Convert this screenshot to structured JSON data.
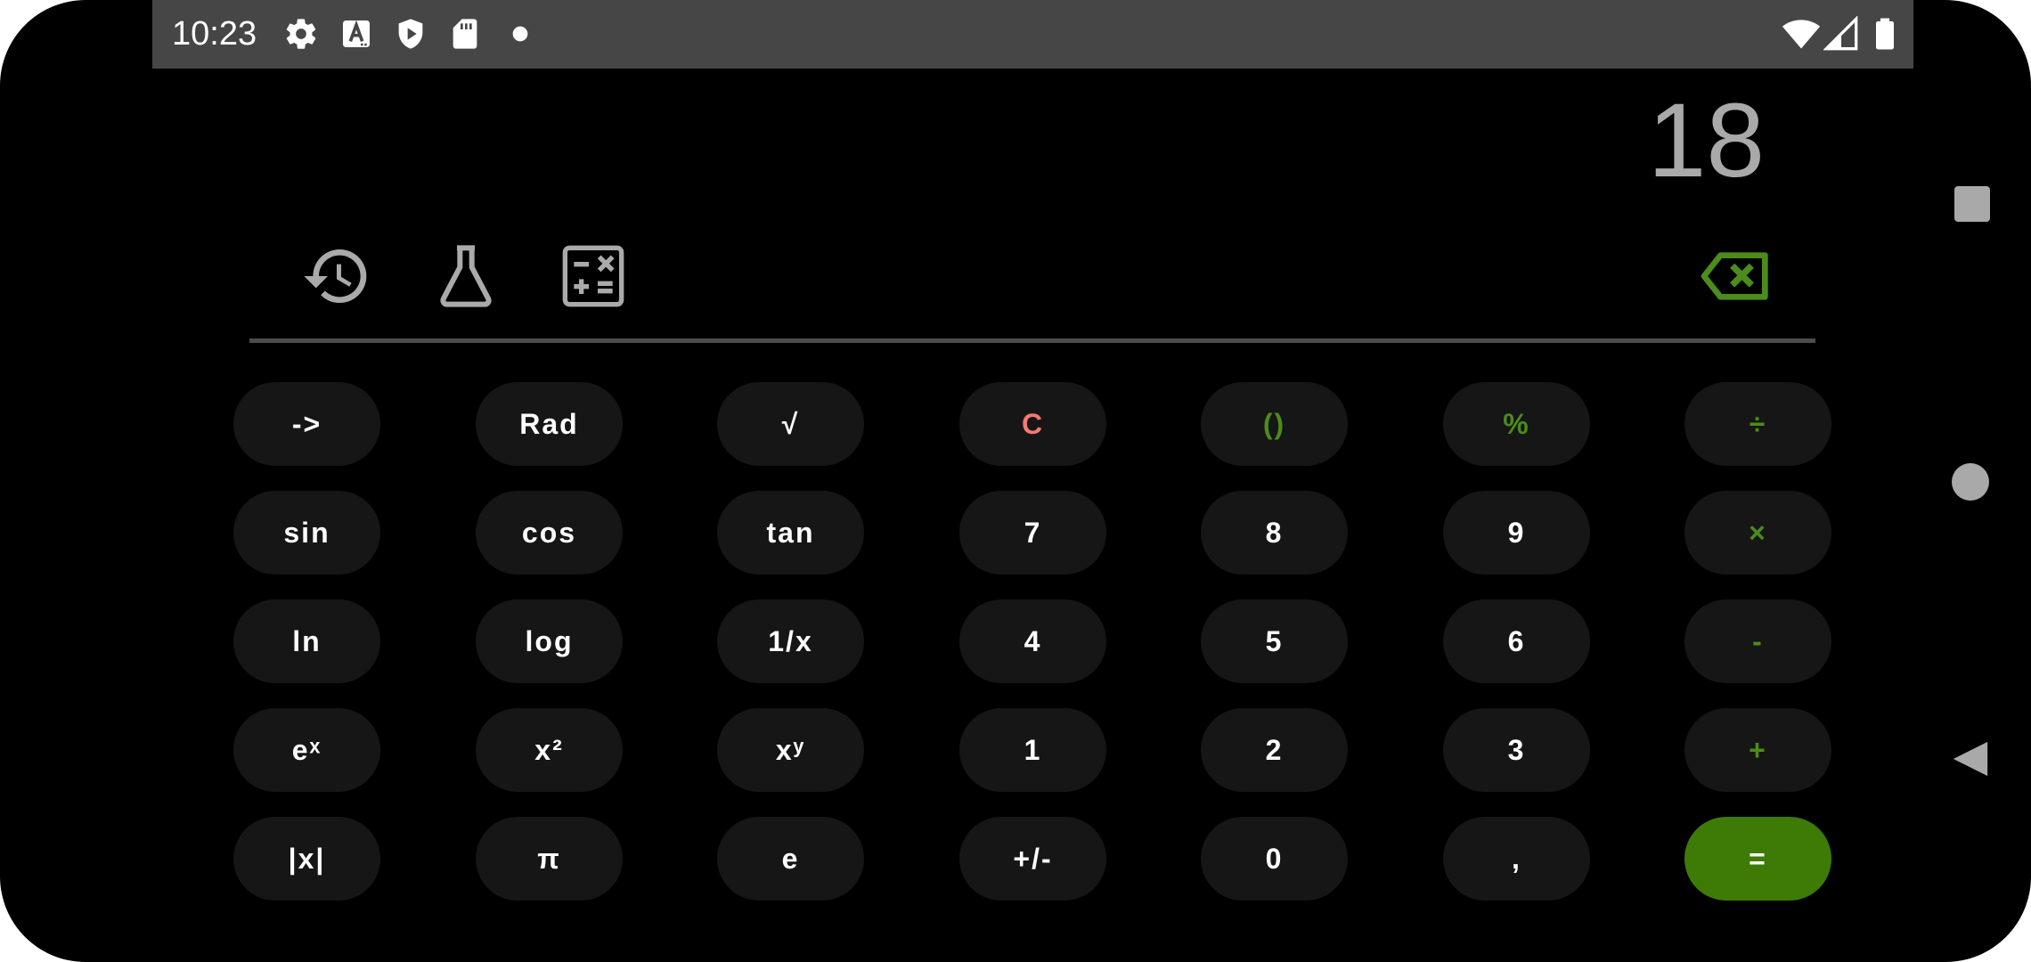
{
  "status_bar": {
    "time": "10:23",
    "icons": [
      "gear-icon",
      "text-a-icon",
      "shield-play-icon",
      "sd-card-icon",
      "dot-icon",
      "wifi-icon",
      "cell-signal-icon",
      "battery-icon"
    ]
  },
  "display": {
    "value": "18"
  },
  "toolbar": {
    "icons": [
      "history-icon",
      "flask-icon",
      "calculator-ops-icon",
      "backspace-icon"
    ]
  },
  "keypad": {
    "rows": [
      [
        "->",
        "Rad",
        "√",
        "C",
        "()",
        "%",
        "÷"
      ],
      [
        "sin",
        "cos",
        "tan",
        "7",
        "8",
        "9",
        "×"
      ],
      [
        "ln",
        "log",
        "1/x",
        "4",
        "5",
        "6",
        "-"
      ],
      [
        "eˣ",
        "x²",
        "xʸ",
        "1",
        "2",
        "3",
        "+"
      ],
      [
        "|x|",
        "π",
        "e",
        "+/-",
        "0",
        ",",
        "="
      ]
    ]
  },
  "colors": {
    "background": "#000000",
    "key": "#161616",
    "accent_green": "#4c8c1a",
    "equals": "#3e7b06",
    "clear_red": "#f07a72",
    "display_text": "#a9a9a9"
  },
  "nav_bar": {
    "buttons": [
      "recents-square-icon",
      "home-circle-icon",
      "back-triangle-icon"
    ]
  }
}
